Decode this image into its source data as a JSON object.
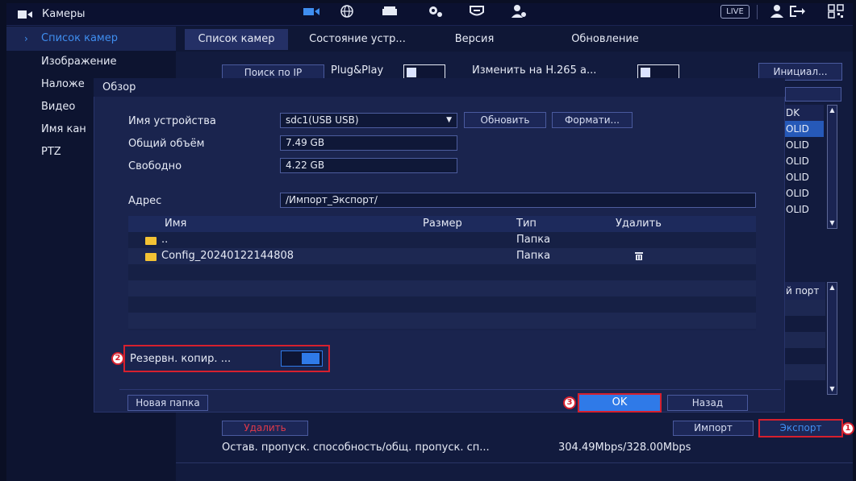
{
  "topbar": {
    "title": "Камеры",
    "live_label": "LIVE",
    "icons": [
      "camera-icon",
      "network-icon",
      "storage-icon",
      "system-settings-icon",
      "security-icon",
      "account-icon",
      "logout-icon",
      "qr-code-icon"
    ]
  },
  "sidebar": {
    "items": [
      {
        "label": "Список камер",
        "active": true
      },
      {
        "label": "Изображение"
      },
      {
        "label": "Наложе"
      },
      {
        "label": "Видео"
      },
      {
        "label": "Имя кан"
      },
      {
        "label": "PTZ"
      }
    ]
  },
  "tabs": [
    "Список камер",
    "Состояние устр...",
    "Версия",
    "Обновление"
  ],
  "toolbar": {
    "search_ip": "Поиск по IP",
    "plug_play": "Plug&Play",
    "h265": "Изменить на H.265 а...",
    "init": "Инициал..."
  },
  "right_table": {
    "header": "DK",
    "cells": [
      "OLID",
      "OLID",
      "OLID",
      "OLID",
      "OLID",
      "OLID"
    ],
    "port_header": "й порт"
  },
  "modal": {
    "title": "Обзор",
    "device_label": "Имя устройства",
    "device_value": "sdc1(USB USB)",
    "refresh_btn": "Обновить",
    "format_btn": "Формати...",
    "total_label": "Общий объём",
    "total_value": "7.49 GB",
    "free_label": "Свободно",
    "free_value": "4.22 GB",
    "address_label": "Адрес",
    "address_value": "/Импорт_Экспорт/",
    "columns": {
      "name": "Имя",
      "size": "Размер",
      "type": "Тип",
      "delete": "Удалить"
    },
    "rows": [
      {
        "name": "..",
        "type": "Папка",
        "deletable": false
      },
      {
        "name": "Config_20240122144808",
        "type": "Папка",
        "deletable": true
      }
    ],
    "backup_label": "Резервн. копир. ...",
    "backup_enabled": true,
    "new_folder_btn": "Новая папка",
    "ok_btn": "OK",
    "back_btn": "Назад"
  },
  "bottom": {
    "delete_btn": "Удалить",
    "import_btn": "Импорт",
    "export_btn": "Экспорт",
    "bandwidth_label": "Остав. пропуск. способность/общ. пропуск. сп...",
    "bandwidth_value": "304.49Mbps/328.00Mbps"
  },
  "markers": [
    "1",
    "2",
    "3"
  ],
  "colors": {
    "accent": "#2f7ae8",
    "highlight": "#d6202e",
    "folder": "#f3c234",
    "delete_text": "#e0394a"
  }
}
